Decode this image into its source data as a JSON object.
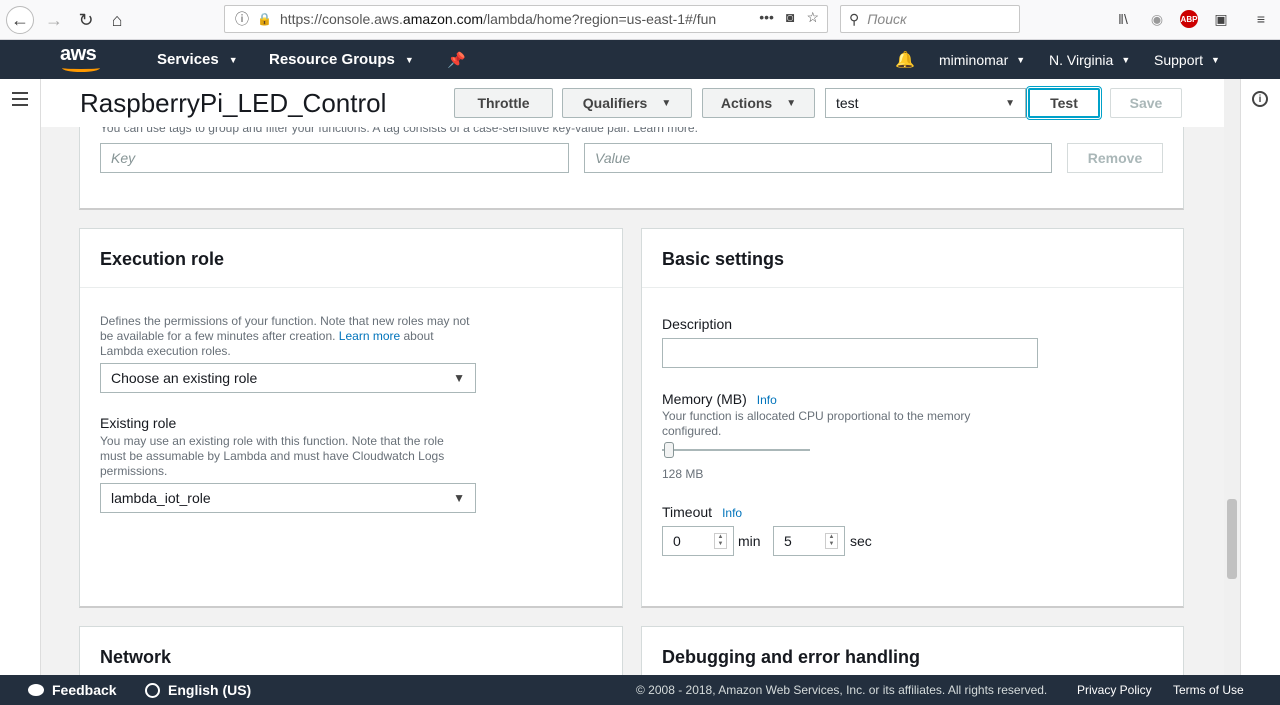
{
  "browser": {
    "url_prefix": "https://console.aws.",
    "url_host": "amazon.com",
    "url_suffix": "/lambda/home?region=us-east-1#/fun",
    "search_placeholder": "Поиск",
    "abp_label": "ABP"
  },
  "aws_nav": {
    "logo": "aws",
    "services": "Services",
    "resource_groups": "Resource Groups",
    "user": "miminomar",
    "region": "N. Virginia",
    "support": "Support"
  },
  "header": {
    "function_name": "RaspberryPi_LED_Control",
    "throttle": "Throttle",
    "qualifiers": "Qualifiers",
    "actions": "Actions",
    "test_event": "test",
    "test": "Test",
    "save": "Save"
  },
  "tags": {
    "hint": "You can use tags to group and filter your functions. A tag consists of a case-sensitive key-value pair. Learn more.",
    "key_placeholder": "Key",
    "value_placeholder": "Value",
    "remove": "Remove"
  },
  "execution_role": {
    "title": "Execution role",
    "desc_part1": "Defines the permissions of your function. Note that new roles may not be available for a few minutes after creation. ",
    "desc_link": "Learn more",
    "desc_part2": " about Lambda execution roles.",
    "role_choice": "Choose an existing role",
    "existing_label": "Existing role",
    "existing_desc": "You may use an existing role with this function. Note that the role must be assumable by Lambda and must have Cloudwatch Logs permissions.",
    "existing_value": "lambda_iot_role"
  },
  "basic_settings": {
    "title": "Basic settings",
    "description_label": "Description",
    "description_value": "",
    "memory_label": "Memory (MB)",
    "info": "Info",
    "memory_desc": "Your function is allocated CPU proportional to the memory configured.",
    "memory_value": "128 MB",
    "timeout_label": "Timeout",
    "timeout_min": "0",
    "min_label": "min",
    "timeout_sec": "5",
    "sec_label": "sec"
  },
  "network": {
    "title": "Network"
  },
  "debugging": {
    "title": "Debugging and error handling"
  },
  "footer": {
    "feedback": "Feedback",
    "language": "English (US)",
    "copyright": "© 2008 - 2018, Amazon Web Services, Inc. or its affiliates. All rights reserved.",
    "privacy": "Privacy Policy",
    "terms": "Terms of Use"
  }
}
